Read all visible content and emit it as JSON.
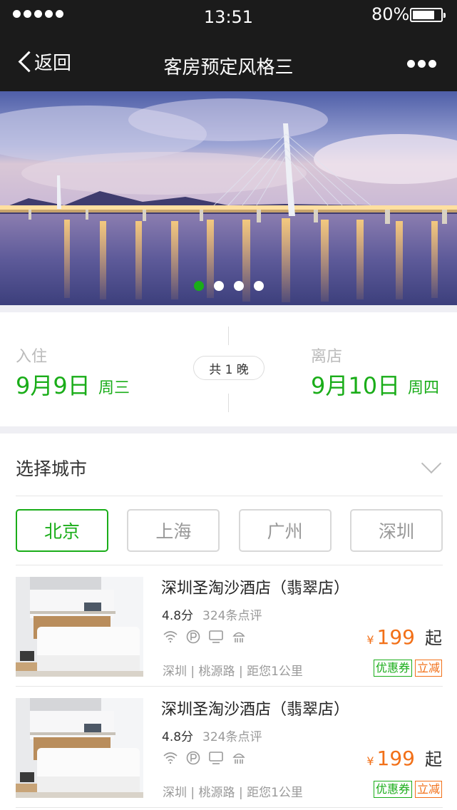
{
  "status": {
    "time": "13:51",
    "battery": "80%",
    "battery_level": 0.8
  },
  "nav": {
    "back_label": "返回",
    "title": "客房预定风格三",
    "more_icon": "more-dots-icon"
  },
  "banner": {
    "slide_count": 4,
    "active_slide": 0
  },
  "booking": {
    "checkin_label": "入住",
    "checkin_date": "9月9日",
    "checkin_weekday": "周三",
    "nights": "共 1 晚",
    "checkout_label": "离店",
    "checkout_date": "9月10日",
    "checkout_weekday": "周四"
  },
  "city": {
    "title": "选择城市",
    "options": [
      "北京",
      "上海",
      "广州",
      "深圳"
    ],
    "selected": "北京"
  },
  "hotels": [
    {
      "name": "深圳圣淘沙酒店（翡翠店）",
      "score": "4.8分",
      "reviews": "324条点评",
      "amenities": [
        "wifi-icon",
        "parking-icon",
        "tv-icon",
        "shower-icon"
      ],
      "price_symbol": "¥",
      "price": "199",
      "price_suffix": "起",
      "location": "深圳 | 桃源路 | 距您1公里",
      "tags": [
        "优惠券",
        "立减"
      ]
    },
    {
      "name": "深圳圣淘沙酒店（翡翠店）",
      "score": "4.8分",
      "reviews": "324条点评",
      "amenities": [
        "wifi-icon",
        "parking-icon",
        "tv-icon",
        "shower-icon"
      ],
      "price_symbol": "¥",
      "price": "199",
      "price_suffix": "起",
      "location": "深圳 | 桃源路 | 距您1公里",
      "tags": [
        "优惠券",
        "立减"
      ]
    }
  ],
  "colors": {
    "accent": "#1aad19",
    "price": "#f27018",
    "nav_bg": "#1b1b1b"
  }
}
